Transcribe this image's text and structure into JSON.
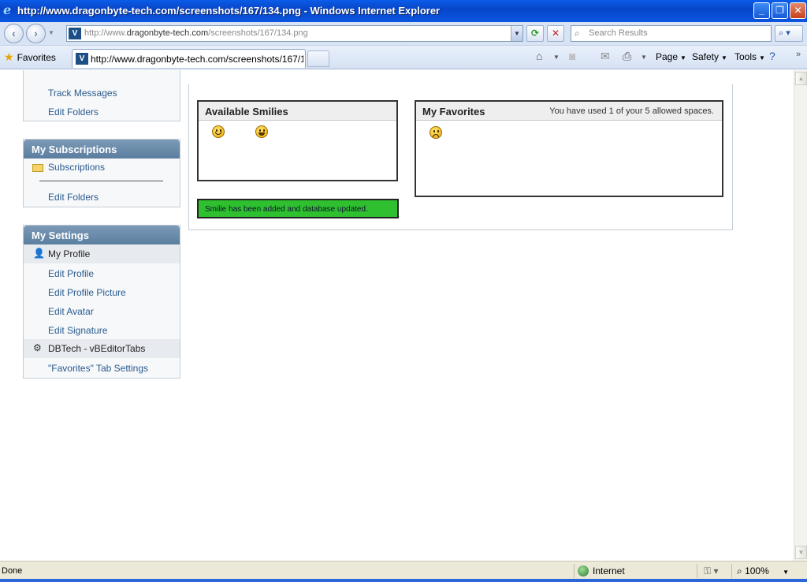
{
  "window": {
    "title": "http://www.dragonbyte-tech.com/screenshots/167/134.png - Windows Internet Explorer",
    "minimize": "_",
    "maximize": "❐",
    "close": "✕"
  },
  "addressbar": {
    "url_prefix": "http://www.",
    "url_domain": "dragonbyte-tech.com",
    "url_path": "/screenshots/167/134.png",
    "search_placeholder": "Search Results"
  },
  "tabs": {
    "favorites_label": "Favorites",
    "active_tab_title": "http://www.dragonbyte-tech.com/screenshots/167/1...",
    "commands": {
      "page": "Page",
      "safety": "Safety",
      "tools": "Tools"
    }
  },
  "sidebar": {
    "top_block_items": [
      "Track Messages",
      "Edit Folders"
    ],
    "subscriptions": {
      "title": "My Subscriptions",
      "folder_label": "Subscriptions",
      "edit_folders": "Edit Folders"
    },
    "settings": {
      "title": "My Settings",
      "profile_section": "My Profile",
      "profile_items": [
        "Edit Profile",
        "Edit Profile Picture",
        "Edit Avatar",
        "Edit Signature"
      ],
      "dbtech_section": "DBTech - vBEditorTabs",
      "dbtech_items": [
        "\"Favorites\" Tab Settings"
      ]
    }
  },
  "main": {
    "available_title": "Available Smilies",
    "favorites_title": "My Favorites",
    "favorites_note": "You have used 1 of your 5 allowed spaces.",
    "success_message": "Smilie has been added and database updated.",
    "available_smilies": [
      "smile-icon",
      "grin-icon"
    ],
    "favorite_smilies": [
      "frown-icon"
    ]
  },
  "statusbar": {
    "status_text": "Done",
    "zone": "Internet",
    "zoom": "100%"
  }
}
